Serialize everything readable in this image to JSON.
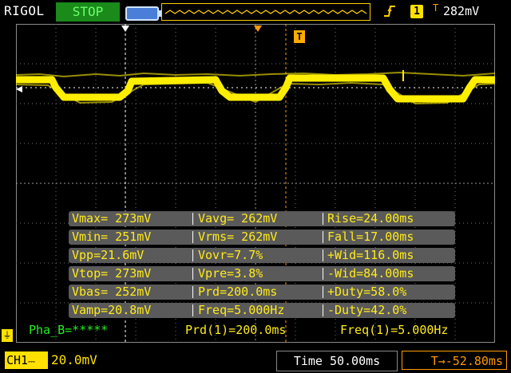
{
  "top_bar": {
    "brand": "RIGOL",
    "run_state": "STOP",
    "trigger_edge_icon": "rising-edge-icon",
    "trigger_channel": "1",
    "trigger_level": "282mV",
    "trigger_position_marker": "T"
  },
  "screen": {
    "trigger_marker": "T",
    "colors": {
      "trace": "#ffee00",
      "grid": "#6f6f6f",
      "cursor": "#ffffff",
      "trigger_line": "#ff9900"
    }
  },
  "measurements": {
    "rows": [
      [
        "Vmax= 273mV",
        "Vavg= 262mV",
        "Rise=24.00ms"
      ],
      [
        "Vmin= 251mV",
        "Vrms= 262mV",
        "Fall=17.00ms"
      ],
      [
        "Vpp=21.6mV",
        "Vovr=7.7%",
        "+Wid=116.0ms"
      ],
      [
        "Vtop= 273mV",
        "Vpre=3.8%",
        "-Wid=84.00ms"
      ],
      [
        "Vbas= 252mV",
        "Prd=200.0ms",
        "+Duty=58.0%"
      ],
      [
        "Vamp=20.8mV",
        "Freq=5.000Hz",
        "-Duty=42.0%"
      ]
    ]
  },
  "bottom": {
    "phase": "Pha_B=*****",
    "prd1": "Prd(1)=200.0ms",
    "freq1": "Freq(1)=5.000Hz",
    "ch1_label": "CH1",
    "ch1_scale": "20.0mV",
    "timebase": "Time 50.00ms",
    "trigger_offset": "T→-52.80ms"
  }
}
